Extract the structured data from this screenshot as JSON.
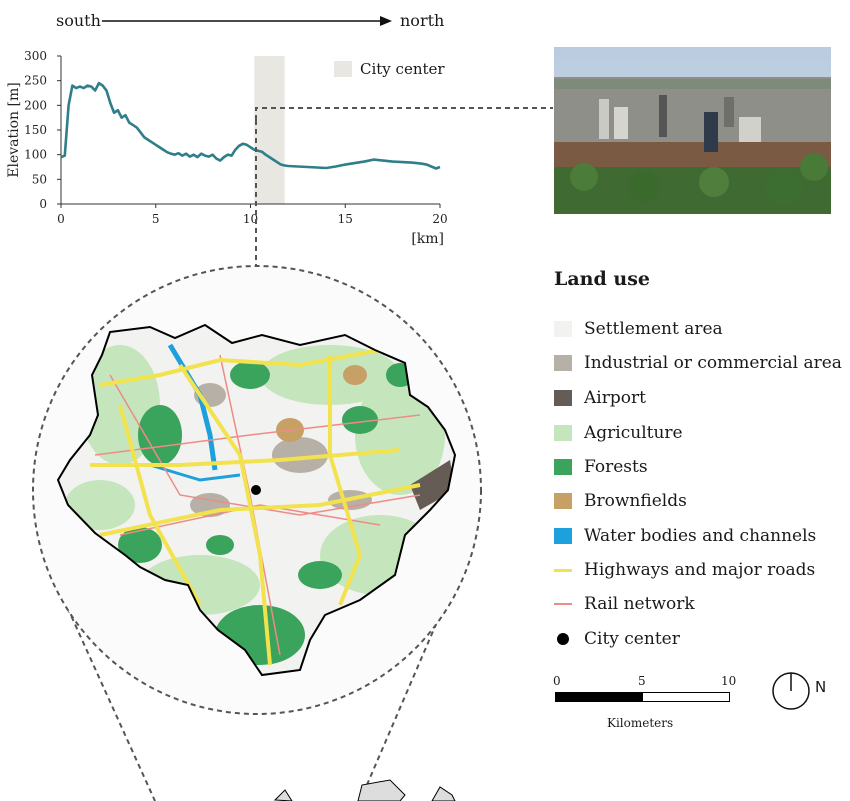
{
  "direction": {
    "start": "south",
    "end": "north"
  },
  "profile_legend": {
    "label": "City center"
  },
  "chart_data": {
    "type": "line",
    "ylabel": "Elevation [m]",
    "xlabel": "[km]",
    "xlim": [
      0,
      20
    ],
    "ylim": [
      0,
      300
    ],
    "xticks": [
      0,
      5,
      10,
      15,
      20
    ],
    "yticks": [
      0,
      50,
      100,
      150,
      200,
      250,
      300
    ],
    "highlight_range": [
      10.2,
      11.8
    ],
    "series": [
      {
        "color": "#2e7f8a",
        "x": [
          0,
          0.2,
          0.4,
          0.6,
          0.8,
          1.0,
          1.2,
          1.4,
          1.6,
          1.8,
          2.0,
          2.2,
          2.4,
          2.6,
          2.8,
          3.0,
          3.2,
          3.4,
          3.6,
          3.8,
          4.0,
          4.2,
          4.4,
          4.6,
          4.8,
          5.0,
          5.2,
          5.4,
          5.6,
          5.8,
          6.0,
          6.2,
          6.4,
          6.6,
          6.8,
          7.0,
          7.2,
          7.4,
          7.6,
          7.8,
          8.0,
          8.2,
          8.4,
          8.6,
          8.8,
          9.0,
          9.2,
          9.4,
          9.6,
          9.8,
          10.0,
          10.2,
          10.4,
          10.6,
          10.8,
          11.0,
          11.2,
          11.4,
          11.6,
          11.8,
          12.0,
          12.5,
          13.0,
          13.5,
          14.0,
          14.5,
          15.0,
          15.5,
          16.0,
          16.5,
          17.0,
          17.5,
          18.0,
          18.5,
          19.0,
          19.3,
          19.6,
          19.8,
          20.0
        ],
        "y": [
          95,
          98,
          200,
          240,
          235,
          238,
          235,
          240,
          238,
          230,
          245,
          240,
          230,
          205,
          185,
          190,
          175,
          180,
          165,
          160,
          155,
          145,
          135,
          130,
          125,
          120,
          115,
          110,
          105,
          102,
          100,
          103,
          98,
          102,
          96,
          100,
          95,
          102,
          98,
          96,
          100,
          92,
          88,
          95,
          100,
          98,
          110,
          118,
          122,
          120,
          115,
          110,
          108,
          106,
          100,
          95,
          90,
          85,
          80,
          78,
          77,
          76,
          75,
          74,
          73,
          76,
          80,
          83,
          86,
          90,
          88,
          86,
          85,
          84,
          82,
          80,
          75,
          72,
          75
        ]
      }
    ]
  },
  "legend": {
    "title": "Land use",
    "items": [
      {
        "label": "Settlement area",
        "color": "#f2f2f0"
      },
      {
        "label": "Industrial or commercial area",
        "color": "#b7b0a6"
      },
      {
        "label": "Airport",
        "color": "#655d55"
      },
      {
        "label": "Agriculture",
        "color": "#c5e6bd"
      },
      {
        "label": "Forests",
        "color": "#3aa35c"
      },
      {
        "label": "Brownfields",
        "color": "#c7a066"
      },
      {
        "label": "Water bodies and channels",
        "color": "#1ea0dd"
      },
      {
        "label": "Highways and major roads",
        "color": "#f2e24e"
      },
      {
        "label": "Rail network",
        "color": "#ee8b86"
      },
      {
        "label": "City center",
        "color": "#000000"
      }
    ]
  },
  "scalebar": {
    "labels": [
      "0",
      "5",
      "10"
    ],
    "unit": "Kilometers"
  },
  "north": "N"
}
